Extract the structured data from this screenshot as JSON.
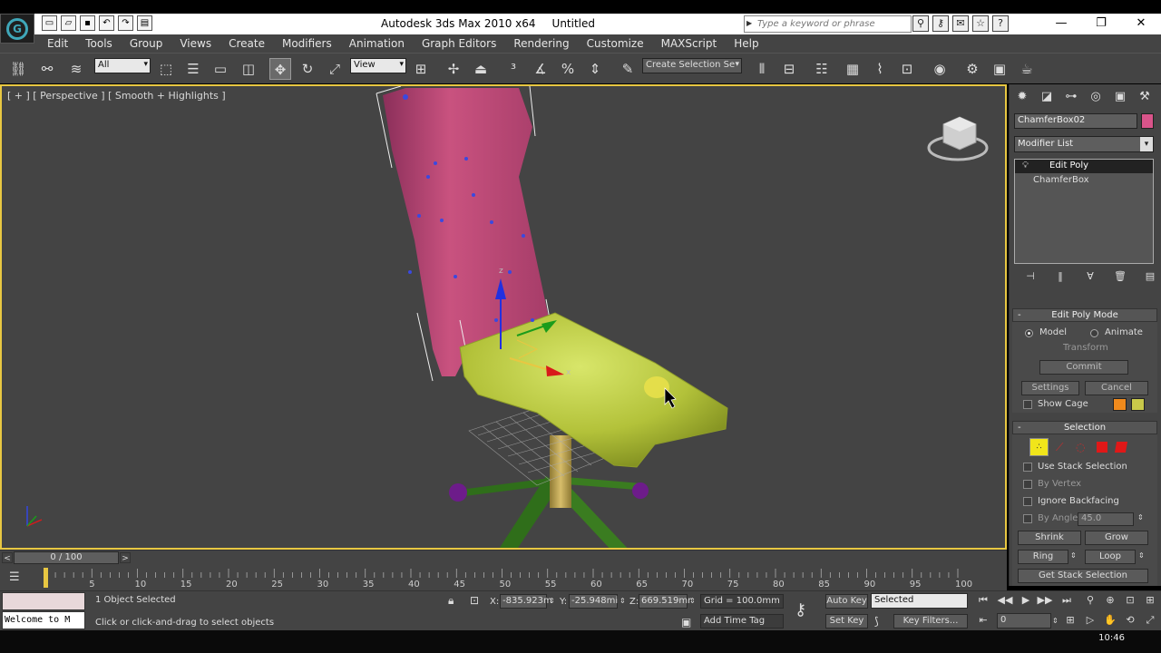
{
  "window": {
    "app_title": "Autodesk 3ds Max  2010 x64",
    "doc_title": "Untitled",
    "search_placeholder": "Type a keyword or phrase",
    "minimize": "—",
    "maximize": "❐",
    "close": "✕"
  },
  "menu": [
    "Edit",
    "Tools",
    "Group",
    "Views",
    "Create",
    "Modifiers",
    "Animation",
    "Graph Editors",
    "Rendering",
    "Customize",
    "MAXScript",
    "Help"
  ],
  "toolbar": {
    "selection_filter": "All",
    "reference_coord": "View",
    "named_selection": "Create Selection Se"
  },
  "viewport": {
    "label": "[ + ] [ Perspective ] [ Smooth + Highlights ]",
    "gizmo_x": "x",
    "gizmo_y": "y",
    "gizmo_z": "z"
  },
  "command_panel": {
    "object_name": "ChamferBox02",
    "object_color": "#d9548a",
    "modifier_list": "Modifier List",
    "stack": [
      "Edit Poly",
      "ChamferBox"
    ],
    "edit_poly_mode": {
      "title": "Edit Poly Mode",
      "model": "Model",
      "animate": "Animate",
      "transform": "Transform",
      "commit": "Commit",
      "settings": "Settings",
      "cancel": "Cancel",
      "show_cage": "Show Cage"
    },
    "selection": {
      "title": "Selection",
      "use_stack": "Use Stack Selection",
      "by_vertex": "By Vertex",
      "ignore_backfacing": "Ignore Backfacing",
      "by_angle": "By Angle:",
      "angle_value": "45.0",
      "shrink": "Shrink",
      "grow": "Grow",
      "ring": "Ring",
      "loop": "Loop",
      "get_stack": "Get Stack Selection"
    }
  },
  "timeline": {
    "frame_display": "0 / 100",
    "ticks": [
      "5",
      "10",
      "15",
      "20",
      "25",
      "30",
      "35",
      "40",
      "45",
      "50",
      "55",
      "60",
      "65",
      "70",
      "75",
      "80",
      "85",
      "90",
      "95",
      "100"
    ]
  },
  "status": {
    "maxscript_listener": "Welcome to M",
    "selection_info": "1 Object Selected",
    "prompt": "Click or click-and-drag to select objects",
    "x_label": "X:",
    "x_value": "-835.923m",
    "y_label": "Y:",
    "y_value": "-25.948mi",
    "z_label": "Z:",
    "z_value": "669.519mr",
    "grid": "Grid = 100.0mm",
    "add_time_tag": "Add Time Tag",
    "auto_key": "Auto Key",
    "selected": "Selected",
    "set_key": "Set Key",
    "key_filters": "Key Filters...",
    "current_frame": "0"
  },
  "taskbar": {
    "clock": "10:46"
  }
}
